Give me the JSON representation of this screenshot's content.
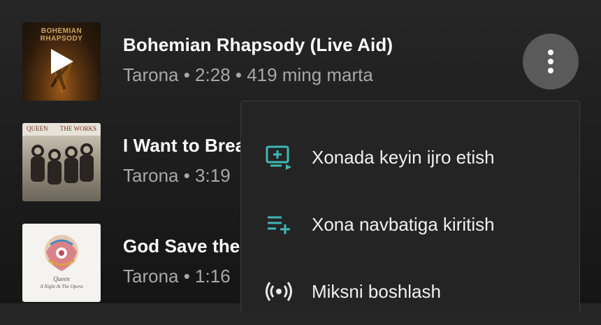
{
  "tracks": [
    {
      "title": "Bohemian Rhapsody (Live Aid)",
      "meta": "Tarona • 2:28 • 419 ming marta",
      "cover_text": "BOHEMIAN RHAPSODY",
      "playing": true
    },
    {
      "title": "I Want to Brea",
      "meta": "Tarona • 3:19",
      "cover_text_left": "QUEEN",
      "cover_text_right": "THE WORKS"
    },
    {
      "title": "God Save the",
      "meta": "Tarona • 1:16",
      "cover_text": "Queen",
      "cover_subtext": "A Night At The Opera"
    }
  ],
  "menu": {
    "items": [
      {
        "label": "Xonada keyin ijro etish",
        "icon": "play-next-icon"
      },
      {
        "label": "Xona navbatiga kiritish",
        "icon": "add-to-queue-icon"
      },
      {
        "label": "Miksni boshlash",
        "icon": "radio-icon"
      }
    ]
  },
  "colors": {
    "accent": "#3fb8b4",
    "meta_text": "#a8a8a8"
  }
}
